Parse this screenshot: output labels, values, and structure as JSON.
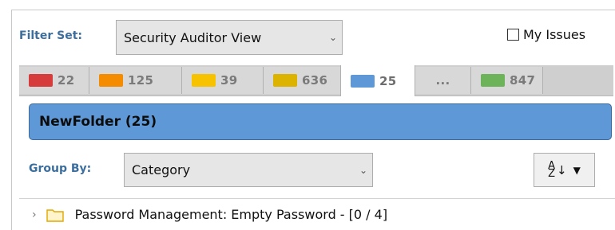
{
  "filter_set": {
    "label": "Filter Set:",
    "value": "Security Auditor View"
  },
  "my_issues": {
    "label": "My Issues",
    "checked": false
  },
  "tabs": [
    {
      "count": "22",
      "color": "#d63c3c"
    },
    {
      "count": "125",
      "color": "#f58c00"
    },
    {
      "count": "39",
      "color": "#f7c300"
    },
    {
      "count": "636",
      "color": "#dcb400"
    },
    {
      "count": "25",
      "color": "#5e98d6",
      "active": true
    },
    {
      "count": "...",
      "color": ""
    },
    {
      "count": "847",
      "color": "#6db35a"
    }
  ],
  "folder": {
    "title": "NewFolder (25)"
  },
  "group_by": {
    "label": "Group By:",
    "value": "Category"
  },
  "sort_button": {
    "icon": "sort-az-icon",
    "az_top": "A",
    "az_bottom": "Z"
  },
  "tree": [
    {
      "label": "Password Management: Empty Password - [0 / 4]",
      "icon": "folder-icon"
    }
  ]
}
